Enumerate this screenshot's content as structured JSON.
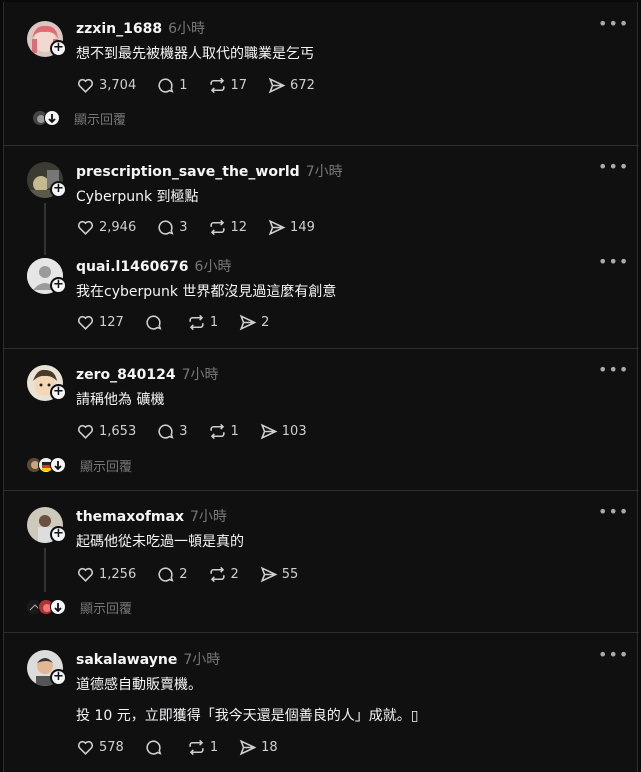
{
  "posts": [
    {
      "username": "zzxin_1688",
      "time": "6小時",
      "text": "想不到最先被機器人取代的職業是乞丐",
      "likes": "3,704",
      "comments": "1",
      "reposts": "17",
      "shares": "672",
      "show_replies": "顯示回覆"
    },
    {
      "username": "prescription_save_the_world",
      "time": "7小時",
      "text": "Cyberpunk 到極點",
      "likes": "2,946",
      "comments": "3",
      "reposts": "12",
      "shares": "149",
      "reply": {
        "username": "quai.l1460676",
        "time": "6小時",
        "text": "我在cyberpunk 世界都沒見過這麼有創意",
        "likes": "127",
        "comments": "",
        "reposts": "1",
        "shares": "2"
      }
    },
    {
      "username": "zero_840124",
      "time": "7小時",
      "text": "請稱他為 礦機",
      "likes": "1,653",
      "comments": "3",
      "reposts": "1",
      "shares": "103",
      "show_replies": "顯示回覆"
    },
    {
      "username": "themaxofmax",
      "time": "7小時",
      "text": "起碼他從未吃過一頓是真的",
      "likes": "1,256",
      "comments": "2",
      "reposts": "2",
      "shares": "55",
      "show_replies": "顯示回覆"
    },
    {
      "username": "sakalawayne",
      "time": "7小時",
      "text": "道德感自動販賣機。",
      "text2": "投 10 元，立即獲得「我今天還是個善良的人」成就。▯",
      "likes": "578",
      "comments": "",
      "reposts": "1",
      "shares": "18"
    }
  ],
  "icons": {
    "like": "heart-icon",
    "comment": "comment-bubble-icon",
    "repost": "repost-icon",
    "share": "send-icon",
    "follow": "plus-icon",
    "more": "more-dots-icon"
  },
  "colors": {
    "background": "#101010",
    "text": "#f3f5f7",
    "muted": "#777777",
    "divider": "#2e2e2e"
  }
}
